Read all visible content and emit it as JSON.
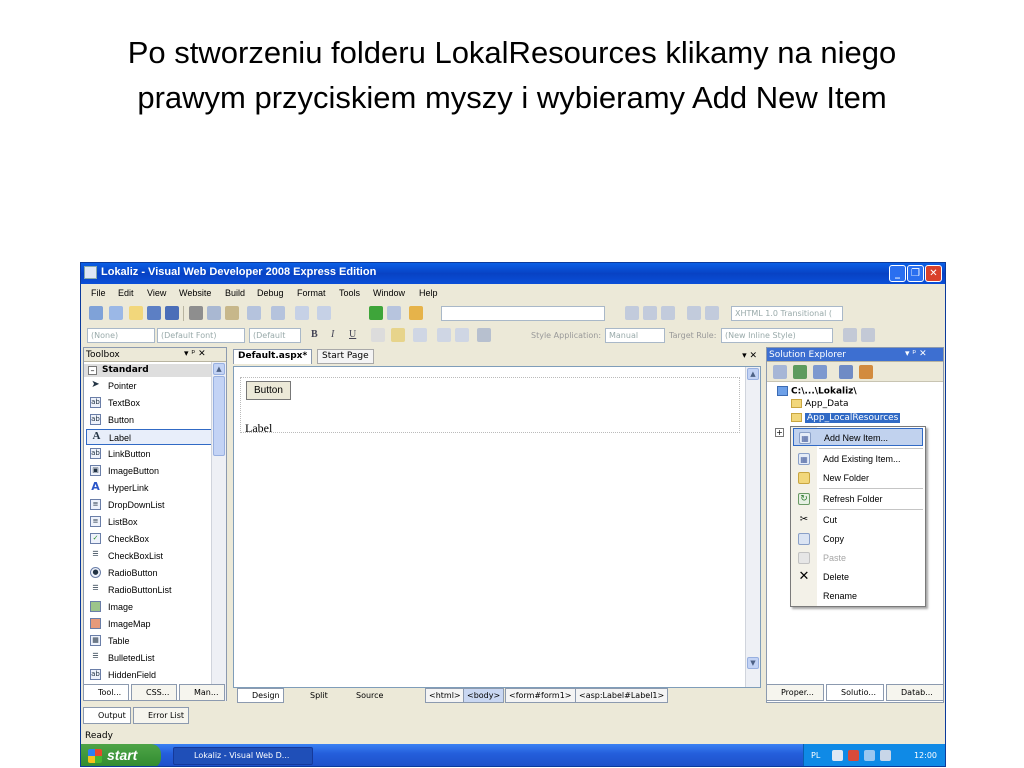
{
  "slide": {
    "title_line1": "Po stworzeniu folderu LokalResources klikamy na niego",
    "title_line2": "prawym przyciskiem myszy i wybieramy Add New Item"
  },
  "window": {
    "title": "Lokaliz - Visual Web Developer 2008 Express Edition",
    "menu": [
      "File",
      "Edit",
      "View",
      "Website",
      "Build",
      "Debug",
      "Format",
      "Tools",
      "Window",
      "Help"
    ]
  },
  "toolbar1": {
    "doctype": "XHTML 1.0 Transitional ("
  },
  "toolbar2": {
    "block": "(None)",
    "font": "(Default Font)",
    "size": "(Default",
    "style_application_label": "Style Application:",
    "style_application_value": "Manual",
    "target_rule_label": "Target Rule:",
    "target_rule_value": "(New Inline Style)"
  },
  "toolbox": {
    "title": "Toolbox",
    "pin": "▾ ᵖ ✕",
    "group": "Standard",
    "items": [
      "Pointer",
      "TextBox",
      "Button",
      "Label",
      "LinkButton",
      "ImageButton",
      "HyperLink",
      "DropDownList",
      "ListBox",
      "CheckBox",
      "CheckBoxList",
      "RadioButton",
      "RadioButtonList",
      "Image",
      "ImageMap",
      "Table",
      "BulletedList",
      "HiddenField"
    ],
    "selected_item": "Label",
    "tabs": [
      "Tool...",
      "CSS...",
      "Man..."
    ]
  },
  "editor": {
    "tabs": [
      "Default.aspx*",
      "Start Page"
    ],
    "controls": "▾ ✕",
    "button_text": "Button",
    "label_text": "Label",
    "view_buttons": [
      "Design",
      "Split",
      "Source"
    ],
    "breadcrumbs": [
      "<html>",
      "<body>",
      "<form#form1>",
      "<asp:Label#Label1>"
    ],
    "active_crumb": "<body>"
  },
  "solution_explorer": {
    "title": "Solution Explorer",
    "controls": "▾ ᵖ ✕",
    "project": "C:\\...\\Lokaliz\\",
    "nodes": [
      "App_Data",
      "App_LocalResources"
    ],
    "tabs": [
      "Proper...",
      "Solutio...",
      "Datab..."
    ]
  },
  "context_menu": {
    "items": [
      {
        "label": "Add New Item...",
        "icon": "add-new-item-icon",
        "state": "hot"
      },
      {
        "label": "Add Existing Item...",
        "icon": "add-existing-item-icon",
        "state": "normal"
      },
      {
        "label": "New Folder",
        "icon": "folder-icon",
        "state": "normal"
      },
      {
        "label": "Refresh Folder",
        "icon": "refresh-icon",
        "state": "normal"
      },
      {
        "label": "Cut",
        "icon": "scissors-icon",
        "state": "normal"
      },
      {
        "label": "Copy",
        "icon": "copy-icon",
        "state": "normal"
      },
      {
        "label": "Paste",
        "icon": "paste-icon",
        "state": "disabled"
      },
      {
        "label": "Delete",
        "icon": "delete-icon",
        "state": "normal"
      },
      {
        "label": "Rename",
        "icon": "",
        "state": "normal"
      }
    ]
  },
  "output_tabs": [
    "Output",
    "Error List"
  ],
  "status": "Ready",
  "taskbar": {
    "start": "start",
    "task": "Lokaliz - Visual Web D...",
    "lang": "PL",
    "clock": "12:00"
  }
}
